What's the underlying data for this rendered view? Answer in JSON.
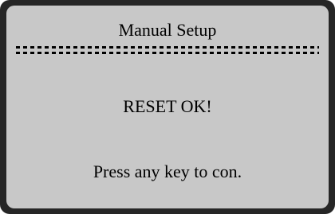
{
  "screen": {
    "title": "Manual Setup",
    "message": "RESET OK!",
    "prompt": "Press any key to con."
  },
  "colors": {
    "bezel": "#262626",
    "screen_background": "#c8c8c8",
    "text": "#000000"
  }
}
